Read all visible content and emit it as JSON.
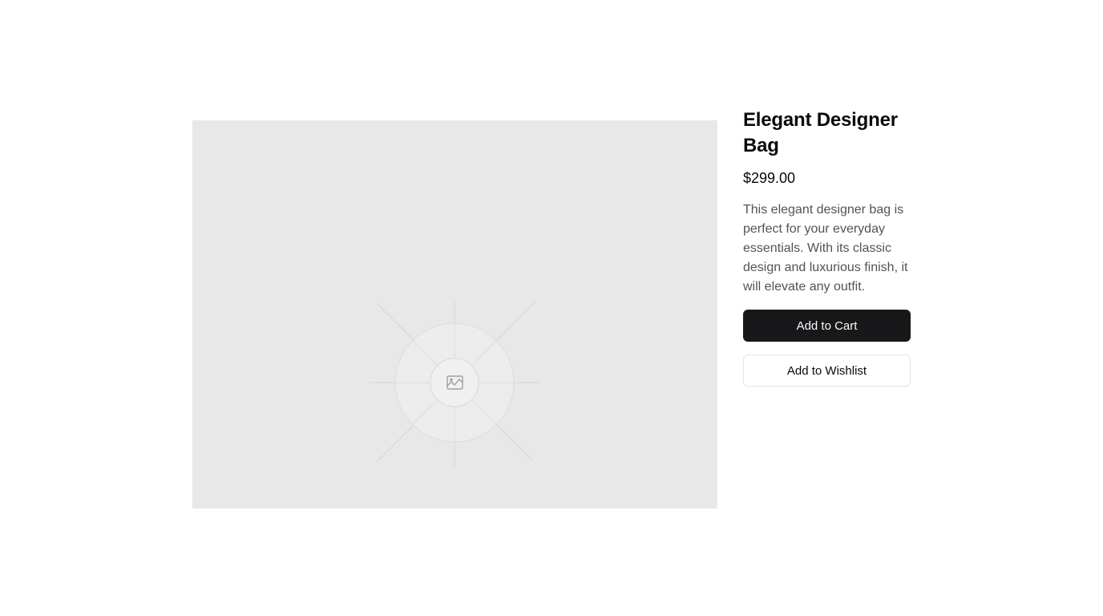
{
  "product": {
    "title": "Elegant Designer Bag",
    "price": "$299.00",
    "description": "This elegant designer bag is perfect for your everyday essentials. With its classic design and luxurious finish, it will elevate any outfit.",
    "image_icon": "image-placeholder-icon"
  },
  "actions": {
    "add_to_cart_label": "Add to Cart",
    "add_to_wishlist_label": "Add to Wishlist"
  },
  "colors": {
    "primary_button_bg": "#18181b",
    "primary_button_text": "#fafafa",
    "description_text": "#52525b",
    "image_placeholder_bg": "#e8e8e8"
  }
}
